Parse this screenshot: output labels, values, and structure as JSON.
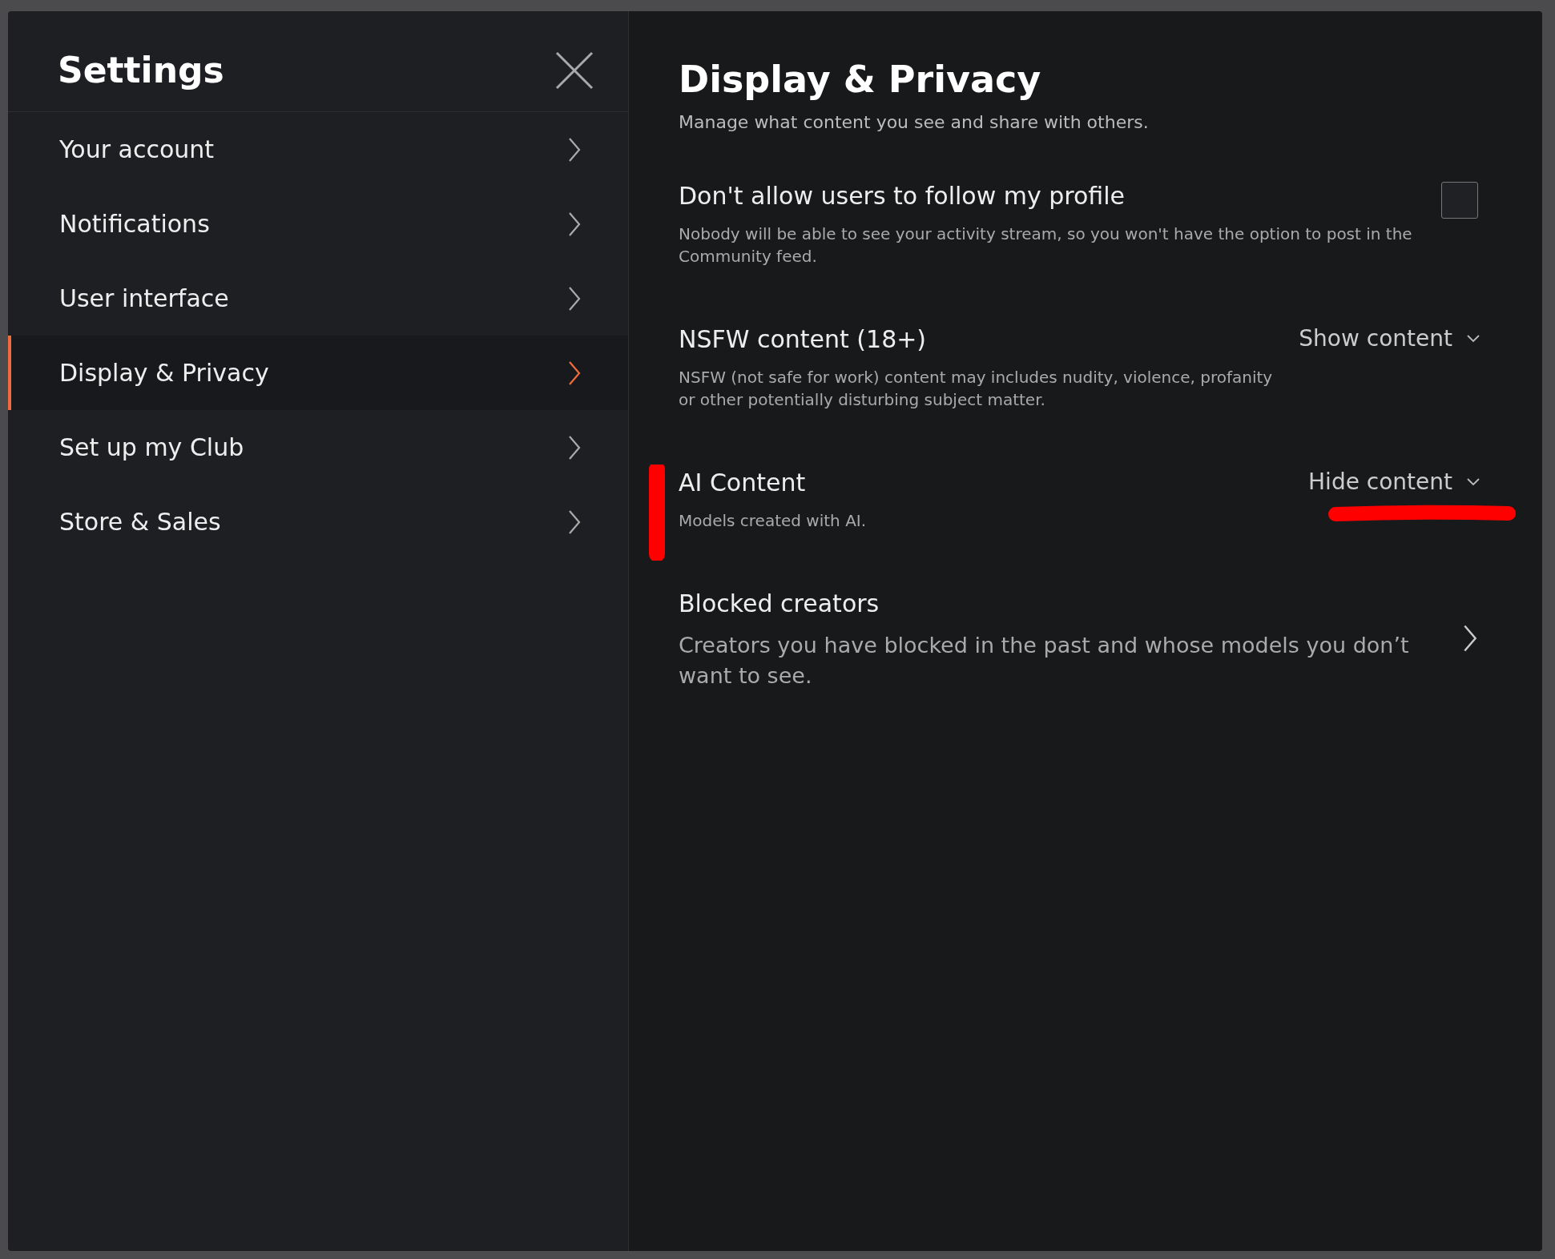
{
  "sidebar": {
    "title": "Settings",
    "items": [
      {
        "label": "Your account",
        "selected": false
      },
      {
        "label": "Notifications",
        "selected": false
      },
      {
        "label": "User interface",
        "selected": false
      },
      {
        "label": "Display & Privacy",
        "selected": true
      },
      {
        "label": "Set up my Club",
        "selected": false
      },
      {
        "label": "Store & Sales",
        "selected": false
      }
    ]
  },
  "panel": {
    "title": "Display & Privacy",
    "subtitle": "Manage what content you see and share with others.",
    "settings": [
      {
        "kind": "checkbox",
        "title": "Don't allow users to follow my profile",
        "description": "Nobody will be able to see your activity stream, so you won't have the option to post in the Community feed.",
        "checked": false
      },
      {
        "kind": "dropdown",
        "title": "NSFW content (18+)",
        "description": "NSFW (not safe for work) content may includes nudity, violence, profanity or other potentially disturbing subject matter.",
        "value": "Show content"
      },
      {
        "kind": "dropdown",
        "title": "AI Content",
        "description": "Models created with AI.",
        "value": "Hide content"
      },
      {
        "kind": "link",
        "title": "Blocked creators",
        "description": "Creators you have blocked in the past and whose models you don’t want to see."
      }
    ]
  }
}
